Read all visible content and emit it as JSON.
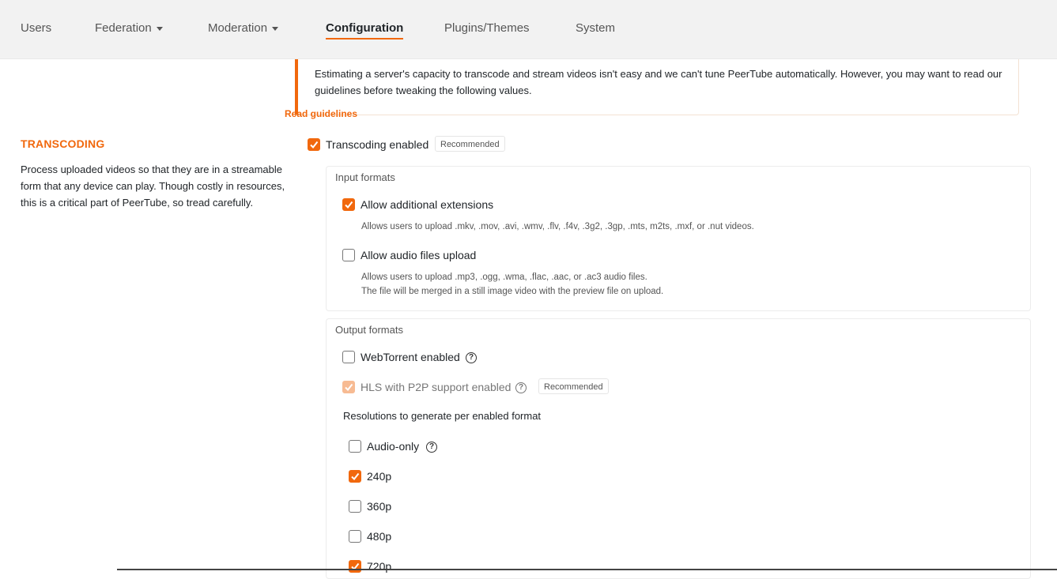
{
  "nav": {
    "items": [
      {
        "label": "Users"
      },
      {
        "label": "Federation"
      },
      {
        "label": "Moderation"
      },
      {
        "label": "Configuration"
      },
      {
        "label": "Plugins/Themes"
      },
      {
        "label": "System"
      }
    ],
    "active": "Configuration"
  },
  "callout": {
    "text": "Estimating a server's capacity to transcode and stream videos isn't easy and we can't tune PeerTube automatically. However, you may want to read our guidelines before tweaking the following values.",
    "link": "Read guidelines"
  },
  "section": {
    "title": "TRANSCODING",
    "description": "Process uploaded videos so that they are in a streamable form that any device can play. Though costly in resources, this is a critical part of PeerTube, so tread carefully."
  },
  "transcoding": {
    "label": "Transcoding enabled",
    "checked": true,
    "badge": "Recommended"
  },
  "input_formats": {
    "legend": "Input formats",
    "additional_extensions": {
      "label": "Allow additional extensions",
      "checked": true,
      "hint": "Allows users to upload .mkv, .mov, .avi, .wmv, .flv, .f4v, .3g2, .3gp, .mts, m2ts, .mxf, or .nut videos."
    },
    "audio_upload": {
      "label": "Allow audio files upload",
      "checked": false,
      "hint1": "Allows users to upload .mp3, .ogg, .wma, .flac, .aac, or .ac3 audio files.",
      "hint2": "The file will be merged in a still image video with the preview file on upload."
    }
  },
  "output_formats": {
    "legend": "Output formats",
    "webtorrent": {
      "label": "WebTorrent enabled",
      "checked": false,
      "help": "?"
    },
    "hls": {
      "label": "HLS with P2P support enabled",
      "checked": true,
      "disabled": true,
      "help": "?",
      "badge": "Recommended"
    },
    "resolutions_label": "Resolutions to generate per enabled format",
    "resolutions": [
      {
        "label": "Audio-only",
        "checked": false,
        "help": "?"
      },
      {
        "label": "240p",
        "checked": true
      },
      {
        "label": "360p",
        "checked": false
      },
      {
        "label": "480p",
        "checked": false
      },
      {
        "label": "720p",
        "checked": true
      }
    ]
  },
  "colors": {
    "accent": "#f1680d",
    "accent_disabled": "#f7bb93",
    "nav_bg": "#f2f2f2"
  }
}
